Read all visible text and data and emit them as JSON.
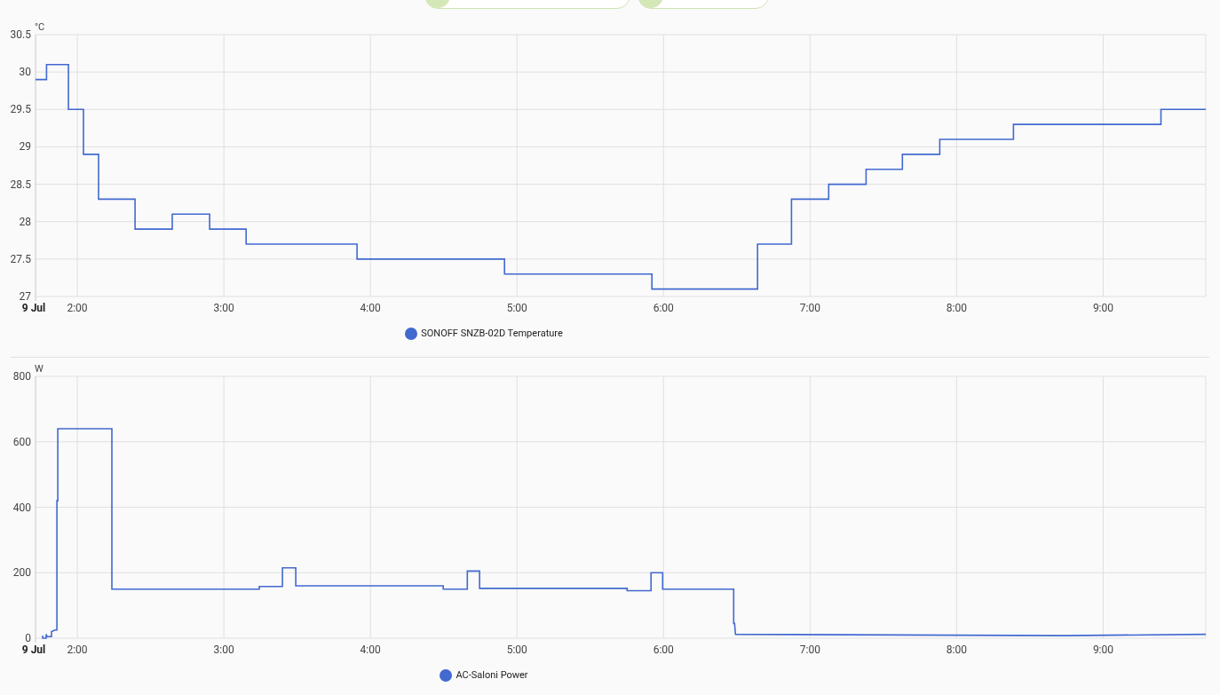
{
  "chips": [
    {
      "kind": "entity"
    },
    {
      "kind": "entity"
    }
  ],
  "charts": [
    {
      "chart_data": {
        "type": "line",
        "grid": true,
        "ylabel": "°C",
        "xlim": [
          1.715,
          9.7
        ],
        "ylim": [
          27,
          30.5
        ],
        "xticks": [
          {
            "value": 1.715,
            "label": "9 Jul"
          },
          {
            "value": 2,
            "label": "2:00"
          },
          {
            "value": 3,
            "label": "3:00"
          },
          {
            "value": 4,
            "label": "4:00"
          },
          {
            "value": 5,
            "label": "5:00"
          },
          {
            "value": 6,
            "label": "6:00"
          },
          {
            "value": 7,
            "label": "7:00"
          },
          {
            "value": 8,
            "label": "8:00"
          },
          {
            "value": 9,
            "label": "9:00"
          }
        ],
        "yticks": [
          27,
          27.5,
          28,
          28.5,
          29,
          29.5,
          30,
          30.5
        ],
        "x": [
          1.715,
          1.79,
          1.79,
          1.94,
          1.94,
          2.042,
          2.042,
          2.145,
          2.145,
          2.394,
          2.394,
          2.648,
          2.648,
          2.903,
          2.903,
          3.152,
          3.152,
          3.909,
          3.909,
          4.915,
          4.915,
          5.921,
          5.921,
          6.642,
          6.642,
          6.873,
          6.873,
          7.127,
          7.127,
          7.382,
          7.382,
          7.63,
          7.63,
          7.885,
          7.885,
          8.388,
          8.388,
          9.394,
          9.394,
          9.7
        ],
        "series": [
          {
            "name": "SONOFF SNZB-02D Temperature",
            "color": "#4269d0",
            "values": [
              29.9,
              29.9,
              30.1,
              30.1,
              29.5,
              29.5,
              28.9,
              28.9,
              28.3,
              28.3,
              27.9,
              27.9,
              28.1,
              28.1,
              27.9,
              27.9,
              27.7,
              27.7,
              27.5,
              27.5,
              27.3,
              27.3,
              27.1,
              27.1,
              27.7,
              27.7,
              28.3,
              28.3,
              28.5,
              28.5,
              28.7,
              28.7,
              28.9,
              28.9,
              29.1,
              29.1,
              29.3,
              29.3,
              29.5,
              29.5
            ]
          }
        ]
      }
    },
    {
      "chart_data": {
        "type": "line",
        "grid": true,
        "ylabel": "W",
        "xlim": [
          1.715,
          9.7
        ],
        "ylim": [
          0,
          800
        ],
        "xticks": [
          {
            "value": 1.715,
            "label": "9 Jul"
          },
          {
            "value": 2,
            "label": "2:00"
          },
          {
            "value": 3,
            "label": "3:00"
          },
          {
            "value": 4,
            "label": "4:00"
          },
          {
            "value": 5,
            "label": "5:00"
          },
          {
            "value": 6,
            "label": "6:00"
          },
          {
            "value": 7,
            "label": "7:00"
          },
          {
            "value": 8,
            "label": "8:00"
          },
          {
            "value": 9,
            "label": "9:00"
          }
        ],
        "yticks": [
          0,
          200,
          400,
          600,
          800
        ],
        "x": [
          1.764,
          1.764,
          1.788,
          1.788,
          1.794,
          1.824,
          1.824,
          1.848,
          1.861,
          1.861,
          1.867,
          1.867,
          2.236,
          2.236,
          3.242,
          3.242,
          3.4,
          3.4,
          3.491,
          3.491,
          4.497,
          4.497,
          4.661,
          4.661,
          4.745,
          4.745,
          5.752,
          5.752,
          5.915,
          5.915,
          5.994,
          5.994,
          6.479,
          6.479,
          6.485,
          6.491,
          8.745,
          9.7
        ],
        "series": [
          {
            "name": "AC-Saloni Power",
            "color": "#4269d0",
            "values": [
              8,
              0,
              0,
              12,
              5,
              5,
              20,
              25,
              25,
              420,
              420,
              640,
              640,
              150,
              150,
              158,
              158,
              215,
              215,
              160,
              160,
              150,
              150,
              205,
              205,
              152,
              152,
              145,
              145,
              200,
              200,
              150,
              150,
              45,
              45,
              12,
              8,
              12
            ]
          }
        ]
      }
    }
  ]
}
